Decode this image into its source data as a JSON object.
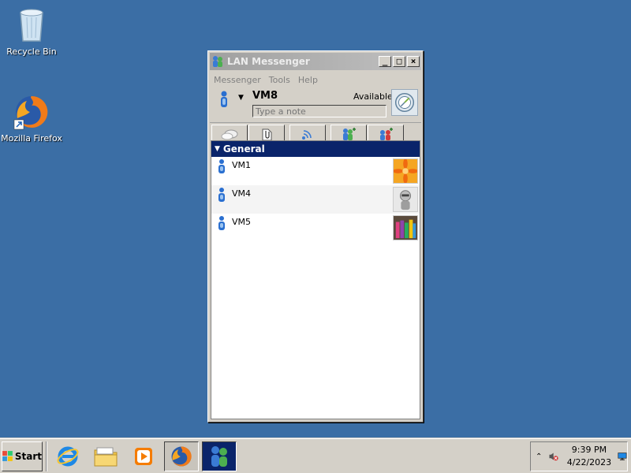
{
  "desktop": {
    "icons": [
      {
        "label": "Recycle Bin",
        "icon": "recycle-bin-icon"
      },
      {
        "label": "Mozilla Firefox",
        "icon": "firefox-icon"
      }
    ]
  },
  "window": {
    "title": "LAN Messenger",
    "controls": {
      "minimize": "_",
      "maximize": "□",
      "close": "×"
    },
    "menu": [
      "Messenger",
      "Tools",
      "Help"
    ],
    "user": {
      "name": "VM8",
      "status": "Available",
      "note_placeholder": "Type a note",
      "note_value": ""
    },
    "toolbar": [
      {
        "icon": "chat-bubble-icon"
      },
      {
        "icon": "attach-file-icon"
      },
      {
        "icon": "broadcast-icon"
      },
      {
        "icon": "add-contact-icon"
      },
      {
        "icon": "add-group-icon"
      }
    ],
    "groups": [
      {
        "name": "General",
        "contacts": [
          {
            "name": "VM1",
            "avatar": "flower-avatar"
          },
          {
            "name": "VM4",
            "avatar": "robot-avatar"
          },
          {
            "name": "VM5",
            "avatar": "markers-avatar"
          }
        ]
      }
    ]
  },
  "taskbar": {
    "start_label": "Start",
    "apps": [
      "internet-explorer-icon",
      "file-explorer-icon",
      "media-player-icon",
      "firefox-icon",
      "lan-messenger-icon"
    ],
    "tray": {
      "time": "9:39 PM",
      "date": "4/22/2023"
    }
  },
  "colors": {
    "desktop": "#3b6ea5",
    "group_header": "#0a246a",
    "window_face": "#d4d0c8"
  }
}
